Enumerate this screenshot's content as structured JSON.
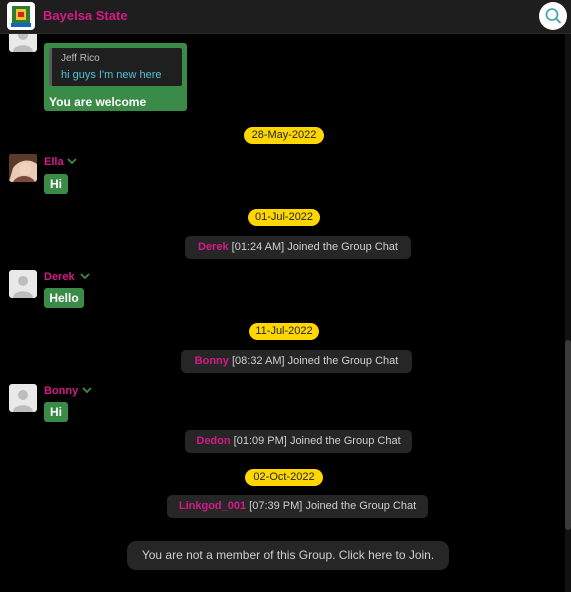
{
  "header": {
    "title": "Bayelsa State",
    "accent_color": "#d6198a",
    "search_icon": "search-icon",
    "logo_icon": "bayelsa-state-logo"
  },
  "messages": {
    "reply": {
      "quoted_name": "Jeff Rico",
      "quoted_text": "hi guys I'm new here",
      "text": "You are welcome"
    },
    "date1": "28-May-2022",
    "ella": {
      "name": "Ella",
      "text": "Hi"
    },
    "date2": "01-Jul-2022",
    "sys1": {
      "who": "Derek",
      "time": "[01:24 AM]",
      "text": "Joined the Group Chat"
    },
    "derek": {
      "name": "Derek",
      "text": "Hello"
    },
    "date3": "11-Jul-2022",
    "sys2": {
      "who": "Bonny",
      "time": "[08:32 AM]",
      "text": "Joined the Group Chat"
    },
    "bonny": {
      "name": "Bonny",
      "text": "Hi"
    },
    "sys3": {
      "who": "Dedon",
      "time": "[01:09 PM]",
      "text": "Joined the Group Chat"
    },
    "date4": "02-Oct-2022",
    "sys4": {
      "who": "Linkgod_001",
      "time": "[07:39 PM]",
      "text": "Joined the Group Chat"
    }
  },
  "footer": {
    "join_text": "You are not a member of this Group. Click here to Join."
  },
  "colors": {
    "bubble": "#3a8b48",
    "date_pill": "#ffd700",
    "system_bg": "#262626",
    "username": "#d6198a"
  }
}
